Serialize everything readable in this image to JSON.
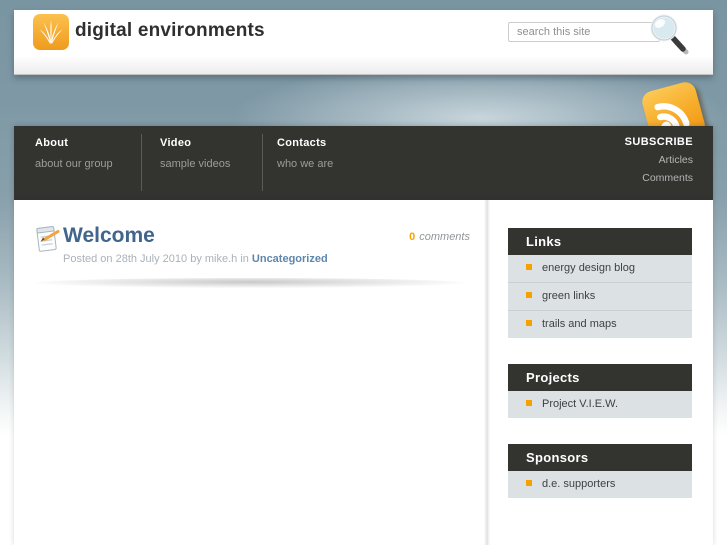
{
  "header": {
    "site_title": "digital environments",
    "search": {
      "placeholder": "search this site"
    }
  },
  "nav": {
    "items": [
      {
        "label": "About",
        "sublabel": "about our group"
      },
      {
        "label": "Video",
        "sublabel": "sample videos"
      },
      {
        "label": "Contacts",
        "sublabel": "who we are"
      }
    ],
    "subscribe_label": "SUBSCRIBE",
    "subscribe_links": [
      {
        "label": "Articles"
      },
      {
        "label": "Comments"
      }
    ]
  },
  "post": {
    "title": "Welcome",
    "meta_prefix": "Posted on 28th July 2010 by mike.h in",
    "category": "Uncategorized",
    "comments_count": "0",
    "comments_label": "comments"
  },
  "sidebar": {
    "sections": [
      {
        "title": "Links",
        "items": [
          {
            "label": "energy design blog"
          },
          {
            "label": "green links"
          },
          {
            "label": "trails and maps"
          }
        ]
      },
      {
        "title": "Projects",
        "items": [
          {
            "label": "Project V.I.E.W."
          }
        ]
      },
      {
        "title": "Sponsors",
        "items": [
          {
            "label": "d.e. supporters"
          }
        ]
      }
    ]
  },
  "icons": {
    "logo": "grass-logo-icon",
    "search": "magnifier-icon",
    "feed": "rss-icon",
    "post": "notepad-pencil-icon"
  },
  "colors": {
    "accent_orange": "#F5A201",
    "dark_bar": "#333330",
    "slate_background": "#7E98A5",
    "link_blue": "#5E86AC",
    "post_title_blue": "#41658C",
    "sidebar_body": "#DCE2E4"
  }
}
